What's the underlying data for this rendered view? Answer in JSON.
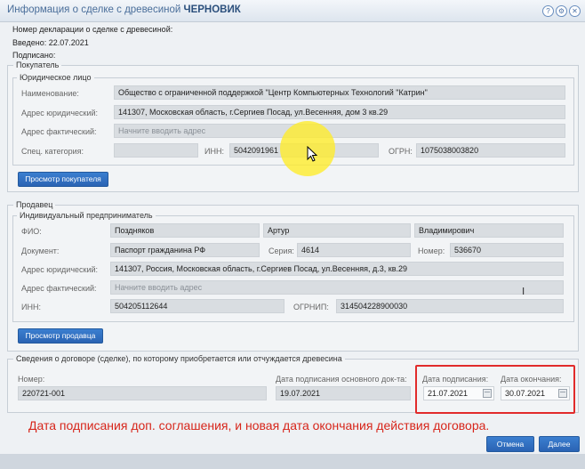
{
  "window": {
    "title": "Информация о сделке с древесиной",
    "status": "ЧЕРНОВИК"
  },
  "header": {
    "declaration_no": "Номер декларации о сделке с древесиной:",
    "entered": "Введено: 22.07.2021",
    "signed": "Подписано:"
  },
  "buyer": {
    "legend": "Покупатель",
    "entity_legend": "Юридическое лицо",
    "name_label": "Наименование:",
    "name_value": "Общество с ограниченной поддержкой \"Центр Компьютерных Технологий \"Катрин\"",
    "legal_addr_label": "Адрес юридический:",
    "legal_addr_value": "141307, Московская область, г.Сергиев Посад, ул.Весенняя, дом 3 кв.29",
    "actual_addr_label": "Адрес фактический:",
    "actual_addr_placeholder": "Начните вводить адрес",
    "spec_label": "Спец. категория:",
    "spec_value": "",
    "inn_label": "ИНН:",
    "inn_value": "5042091961",
    "ogrn_label": "ОГРН:",
    "ogrn_value": "1075038003820",
    "view_button": "Просмотр покупателя"
  },
  "seller": {
    "legend": "Продавец",
    "entity_legend": "Индивидуальный предприниматель",
    "fio_label": "ФИО:",
    "last_name": "Поздняков",
    "first_name": "Артур",
    "middle_name": "Владимирович",
    "doc_label": "Документ:",
    "doc_value": "Паспорт гражданина РФ",
    "series_label": "Серия:",
    "series_value": "4614",
    "number_label": "Номер:",
    "number_value": "536670",
    "legal_addr_label": "Адрес юридический:",
    "legal_addr_value": "141307, Россия, Московская область, г.Сергиев Посад, ул.Весенняя, д.3, кв.29",
    "actual_addr_label": "Адрес фактический:",
    "actual_addr_placeholder": "Начните вводить адрес",
    "inn_label": "ИНН:",
    "inn_value": "504205112644",
    "ogrnip_label": "ОГРНИП:",
    "ogrnip_value": "314504228900030",
    "view_button": "Просмотр продавца"
  },
  "contract": {
    "legend": "Сведения о договоре (сделке), по которому приобретается или отчуждается древесина",
    "number_label": "Номер:",
    "number_value": "220721-001",
    "main_date_label": "Дата подписания основного док-та:",
    "main_date_value": "19.07.2021",
    "sign_date_label": "Дата подписания:",
    "sign_date_value": "21.07.2021",
    "end_date_label": "Дата окончания:",
    "end_date_value": "30.07.2021"
  },
  "annotation": "Дата подписания доп. соглашения, и новая дата окончания действия договора.",
  "footer": {
    "cancel": "Отмена",
    "next": "Далее"
  },
  "colors": {
    "accent": "#2a63b3",
    "highlight": "#e12b2b",
    "cursor_spot": "#ffec28"
  }
}
